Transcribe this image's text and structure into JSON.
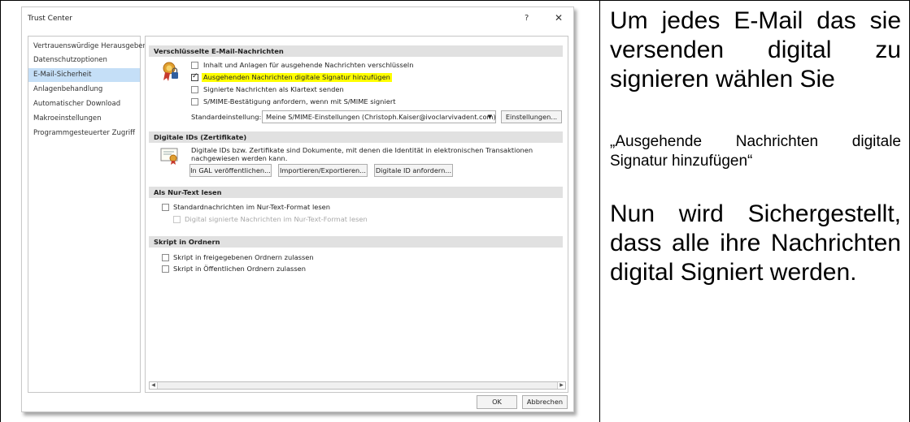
{
  "dialog": {
    "title": "Trust Center",
    "help": "?",
    "close": "✕",
    "sidebar": [
      "Vertrauenswürdige Herausgeber",
      "Datenschutzoptionen",
      "E-Mail-Sicherheit",
      "Anlagenbehandlung",
      "Automatischer Download",
      "Makroeinstellungen",
      "Programmgesteuerter Zugriff"
    ],
    "active_item": "E-Mail-Sicherheit",
    "sections": {
      "encrypted": {
        "header": "Verschlüsselte E-Mail-Nachrichten",
        "options": [
          {
            "label": "Inhalt und Anlagen für ausgehende Nachrichten verschlüsseln",
            "checked": false
          },
          {
            "label": "Ausgehenden Nachrichten digitale Signatur hinzufügen",
            "checked": true,
            "highlighted": true
          },
          {
            "label": "Signierte Nachrichten als Klartext senden",
            "checked": false
          },
          {
            "label": "S/MIME-Bestätigung anfordern, wenn mit S/MIME signiert",
            "checked": false
          }
        ],
        "default_label": "Standardeinstellung:",
        "default_value": "Meine S/MIME-Einstellungen (Christoph.Kaiser@ivoclarvivadent.com)",
        "settings_button": "Einstellungen..."
      },
      "digital_ids": {
        "header": "Digitale IDs (Zertifikate)",
        "description": "Digitale IDs bzw. Zertifikate sind Dokumente, mit denen die Identität in elektronischen Transaktionen nachgewiesen werden kann.",
        "buttons": [
          "In GAL veröffentlichen...",
          "Importieren/Exportieren...",
          "Digitale ID anfordern..."
        ]
      },
      "plain_text": {
        "header": "Als Nur-Text lesen",
        "options": [
          {
            "label": "Standardnachrichten im Nur-Text-Format lesen",
            "checked": false,
            "disabled": false
          },
          {
            "label": "Digital signierte Nachrichten im Nur-Text-Format lesen",
            "checked": false,
            "disabled": true
          }
        ]
      },
      "script": {
        "header": "Skript in Ordnern",
        "options": [
          {
            "label": "Skript in freigegebenen Ordnern zulassen",
            "checked": false
          },
          {
            "label": "Skript in Öffentlichen Ordnern zulassen",
            "checked": false
          }
        ]
      }
    },
    "ok": "OK",
    "cancel": "Abbrechen"
  },
  "instructions": {
    "intro": "Um jedes E-Mail das sie versenden digital zu signieren wählen Sie",
    "quote": "„Ausgehende Nachrichten digitale Signatur hinzufügen“",
    "result": "Nun wird Sichergestellt, dass alle ihre Nachrichten digital Signiert werden."
  }
}
